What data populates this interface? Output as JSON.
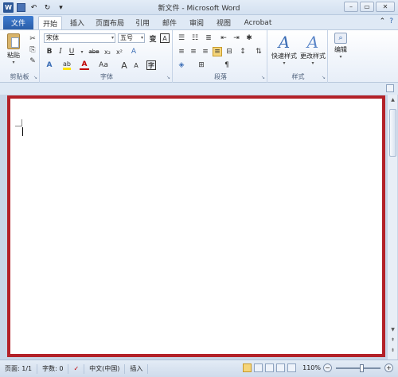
{
  "title": "新文件 - Microsoft Word",
  "quick_access": {
    "app_icon": "W"
  },
  "window_controls": {
    "minimize": "–",
    "restore": "▭",
    "close": "✕"
  },
  "tabs": {
    "file": "文件",
    "home": "开始",
    "insert": "插入",
    "page_layout": "页面布局",
    "references": "引用",
    "mailings": "邮件",
    "review": "审阅",
    "view": "视图",
    "acrobat": "Acrobat"
  },
  "ribbon": {
    "clipboard": {
      "label": "剪贴板",
      "paste": "粘贴"
    },
    "font": {
      "label": "字体",
      "font_name": "宋体",
      "font_size": "五号",
      "bold": "B",
      "italic": "I",
      "underline": "U",
      "strikethrough": "abe",
      "subscript": "x₂",
      "superscript": "x²",
      "grow": "A",
      "shrink": "A",
      "change_case": "Aa",
      "font_color": "A",
      "clear_format": "A",
      "pinyin": "变",
      "char_border": "A"
    },
    "paragraph": {
      "label": "段落"
    },
    "styles": {
      "label": "样式",
      "quick_styles": "快速样式",
      "change_styles": "更改样式"
    },
    "editing": {
      "label": "编辑"
    }
  },
  "status": {
    "page": "页面: 1/1",
    "words": "字数: 0",
    "language": "中文(中国)",
    "mode": "插入",
    "zoom": "110%",
    "zoom_level_percent": 110
  },
  "colors": {
    "page_border": "#b32128",
    "file_tab": "#2a5ea8",
    "ribbon_bg": "#e7eef8"
  }
}
